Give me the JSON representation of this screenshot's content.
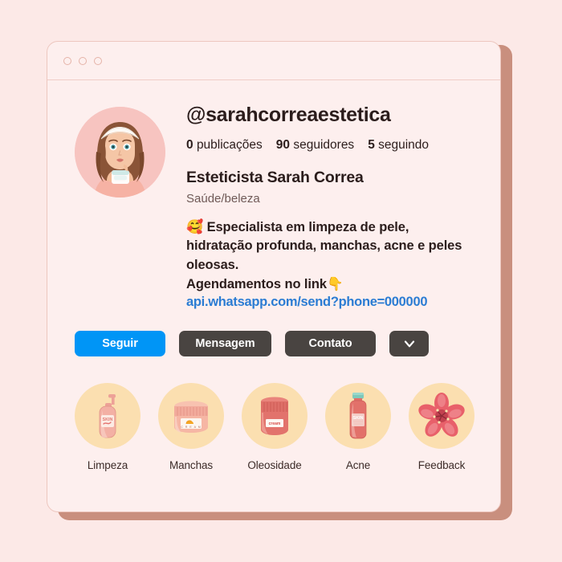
{
  "window": {
    "traffic_dots": 3
  },
  "profile": {
    "avatar_alt": "woman-with-cream-jar-avatar",
    "handle": "@sarahcorreaestetica",
    "stats": [
      {
        "num": "0",
        "unit": "publicações"
      },
      {
        "num": "90",
        "unit": "seguidores"
      },
      {
        "num": "5",
        "unit": "seguindo"
      }
    ],
    "full_name": "Esteticista Sarah Correa",
    "category": "Saúde/beleza",
    "bio_emoji": "🥰",
    "bio_text": "Especialista em limpeza de pele, hidratação profunda, manchas, acne e peles oleosas.",
    "bio_line2": "Agendamentos no link",
    "bio_line2_emoji": "👇",
    "bio_link": "api.whatsapp.com/send?phone=000000"
  },
  "actions": {
    "follow": "Seguir",
    "message": "Mensagem",
    "contact": "Contato",
    "more_icon": "chevron-down-icon"
  },
  "highlights": [
    {
      "label": "Limpeza",
      "icon": "pump-bottle-icon"
    },
    {
      "label": "Manchas",
      "icon": "cream-jar-wide-icon"
    },
    {
      "label": "Oleosidade",
      "icon": "cream-jar-tall-icon"
    },
    {
      "label": "Acne",
      "icon": "skin-bottle-icon"
    },
    {
      "label": "Feedback",
      "icon": "flower-icon"
    }
  ],
  "colors": {
    "page_background": "#fce9e7",
    "window_background": "#fdefee",
    "window_shadow": "#c98f7e",
    "follow_blue": "#0095f6",
    "dark_button": "#494441",
    "link_blue": "#2b7cd3",
    "highlight_circle": "#fbdfb0",
    "avatar_background": "#f7c4c0"
  }
}
